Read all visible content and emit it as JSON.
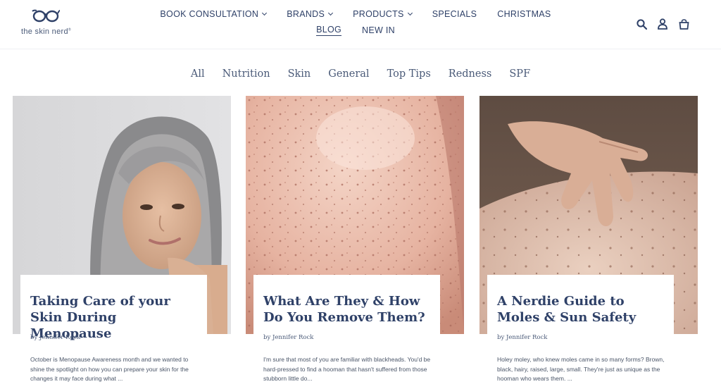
{
  "brand": {
    "logo_text": "the skin nerd",
    "logo_mark": "®"
  },
  "nav": {
    "items": [
      {
        "label": "BOOK CONSULTATION",
        "dropdown": true,
        "name": "nav-book-consultation"
      },
      {
        "label": "BRANDS",
        "dropdown": true,
        "name": "nav-brands"
      },
      {
        "label": "PRODUCTS",
        "dropdown": true,
        "name": "nav-products"
      },
      {
        "label": "SPECIALS",
        "dropdown": false,
        "name": "nav-specials"
      },
      {
        "label": "CHRISTMAS",
        "dropdown": false,
        "name": "nav-christmas"
      },
      {
        "label": "BLOG",
        "dropdown": false,
        "name": "nav-blog",
        "active": true
      },
      {
        "label": "NEW IN",
        "dropdown": false,
        "name": "nav-new-in"
      }
    ]
  },
  "header_icons": [
    "search-icon",
    "account-icon",
    "cart-icon"
  ],
  "filters": [
    "All",
    "Nutrition",
    "Skin",
    "General",
    "Top Tips",
    "Redness",
    "SPF"
  ],
  "posts": [
    {
      "title": "Taking Care of your Skin During Menopause",
      "author": "by Jennifer Rock",
      "excerpt": "October is Menopause Awareness month and we wanted to shine the spotlight on how you can prepare your skin for the changes it may face during what ..."
    },
    {
      "title": "What Are They & How Do You Remove Them?",
      "author": "by Jennifer Rock",
      "excerpt": " I'm sure that most of you are familiar with blackheads. You'd be hard-pressed to find a hooman that hasn't suffered from those stubborn little do..."
    },
    {
      "title": "A Nerdie Guide to Moles & Sun Safety",
      "author": "by Jennifer Rock",
      "excerpt": "Holey moley, who knew moles came in so many forms? Brown, black, hairy, raised, large, small. They're just as unique as the hooman who wears them. ..."
    }
  ],
  "colors": {
    "brand_navy": "#2f4168",
    "text_muted": "#4a5a78"
  }
}
